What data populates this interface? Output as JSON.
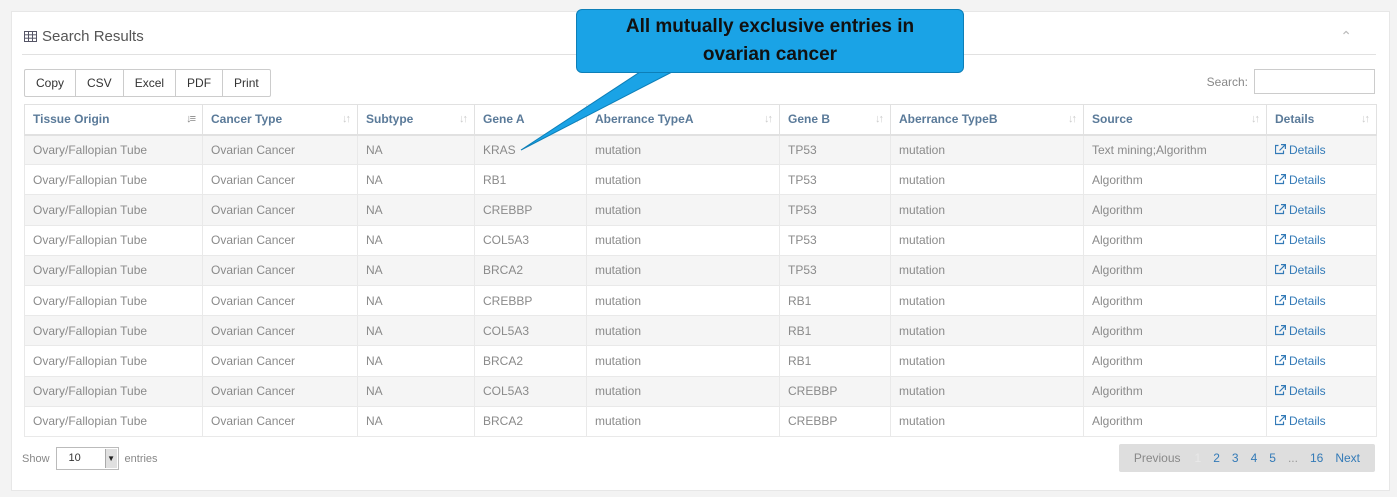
{
  "panel": {
    "title": "Search Results",
    "title_icon": "table-icon",
    "collapse_icon": "chevron-up-icon"
  },
  "export_buttons": [
    "Copy",
    "CSV",
    "Excel",
    "PDF",
    "Print"
  ],
  "search": {
    "label": "Search:",
    "value": "",
    "placeholder": ""
  },
  "table": {
    "columns": [
      {
        "label": "Tissue Origin",
        "sort": "asc"
      },
      {
        "label": "Cancer Type",
        "sort": "none"
      },
      {
        "label": "Subtype",
        "sort": "none"
      },
      {
        "label": "Gene A",
        "sort": "none"
      },
      {
        "label": "Aberrance TypeA",
        "sort": "none"
      },
      {
        "label": "Gene B",
        "sort": "none"
      },
      {
        "label": "Aberrance TypeB",
        "sort": "none"
      },
      {
        "label": "Source",
        "sort": "none"
      },
      {
        "label": "Details",
        "sort": "none"
      }
    ],
    "rows": [
      [
        "Ovary/Fallopian Tube",
        "Ovarian Cancer",
        "NA",
        "KRAS",
        "mutation",
        "TP53",
        "mutation",
        "Text mining;Algorithm",
        "Details"
      ],
      [
        "Ovary/Fallopian Tube",
        "Ovarian Cancer",
        "NA",
        "RB1",
        "mutation",
        "TP53",
        "mutation",
        "Algorithm",
        "Details"
      ],
      [
        "Ovary/Fallopian Tube",
        "Ovarian Cancer",
        "NA",
        "CREBBP",
        "mutation",
        "TP53",
        "mutation",
        "Algorithm",
        "Details"
      ],
      [
        "Ovary/Fallopian Tube",
        "Ovarian Cancer",
        "NA",
        "COL5A3",
        "mutation",
        "TP53",
        "mutation",
        "Algorithm",
        "Details"
      ],
      [
        "Ovary/Fallopian Tube",
        "Ovarian Cancer",
        "NA",
        "BRCA2",
        "mutation",
        "TP53",
        "mutation",
        "Algorithm",
        "Details"
      ],
      [
        "Ovary/Fallopian Tube",
        "Ovarian Cancer",
        "NA",
        "CREBBP",
        "mutation",
        "RB1",
        "mutation",
        "Algorithm",
        "Details"
      ],
      [
        "Ovary/Fallopian Tube",
        "Ovarian Cancer",
        "NA",
        "COL5A3",
        "mutation",
        "RB1",
        "mutation",
        "Algorithm",
        "Details"
      ],
      [
        "Ovary/Fallopian Tube",
        "Ovarian Cancer",
        "NA",
        "BRCA2",
        "mutation",
        "RB1",
        "mutation",
        "Algorithm",
        "Details"
      ],
      [
        "Ovary/Fallopian Tube",
        "Ovarian Cancer",
        "NA",
        "COL5A3",
        "mutation",
        "CREBBP",
        "mutation",
        "Algorithm",
        "Details"
      ],
      [
        "Ovary/Fallopian Tube",
        "Ovarian Cancer",
        "NA",
        "BRCA2",
        "mutation",
        "CREBBP",
        "mutation",
        "Algorithm",
        "Details"
      ]
    ]
  },
  "length_menu": {
    "show_label": "Show",
    "value": "10",
    "entries_label": "entries"
  },
  "pagination": {
    "previous": "Previous",
    "current": "1",
    "pages": [
      "2",
      "3",
      "4",
      "5"
    ],
    "ellipsis": "...",
    "last": "16",
    "next": "Next"
  },
  "callout": {
    "line1": "All mutually exclusive entries in",
    "line2": "ovarian cancer",
    "color": "#1aa3e6"
  }
}
